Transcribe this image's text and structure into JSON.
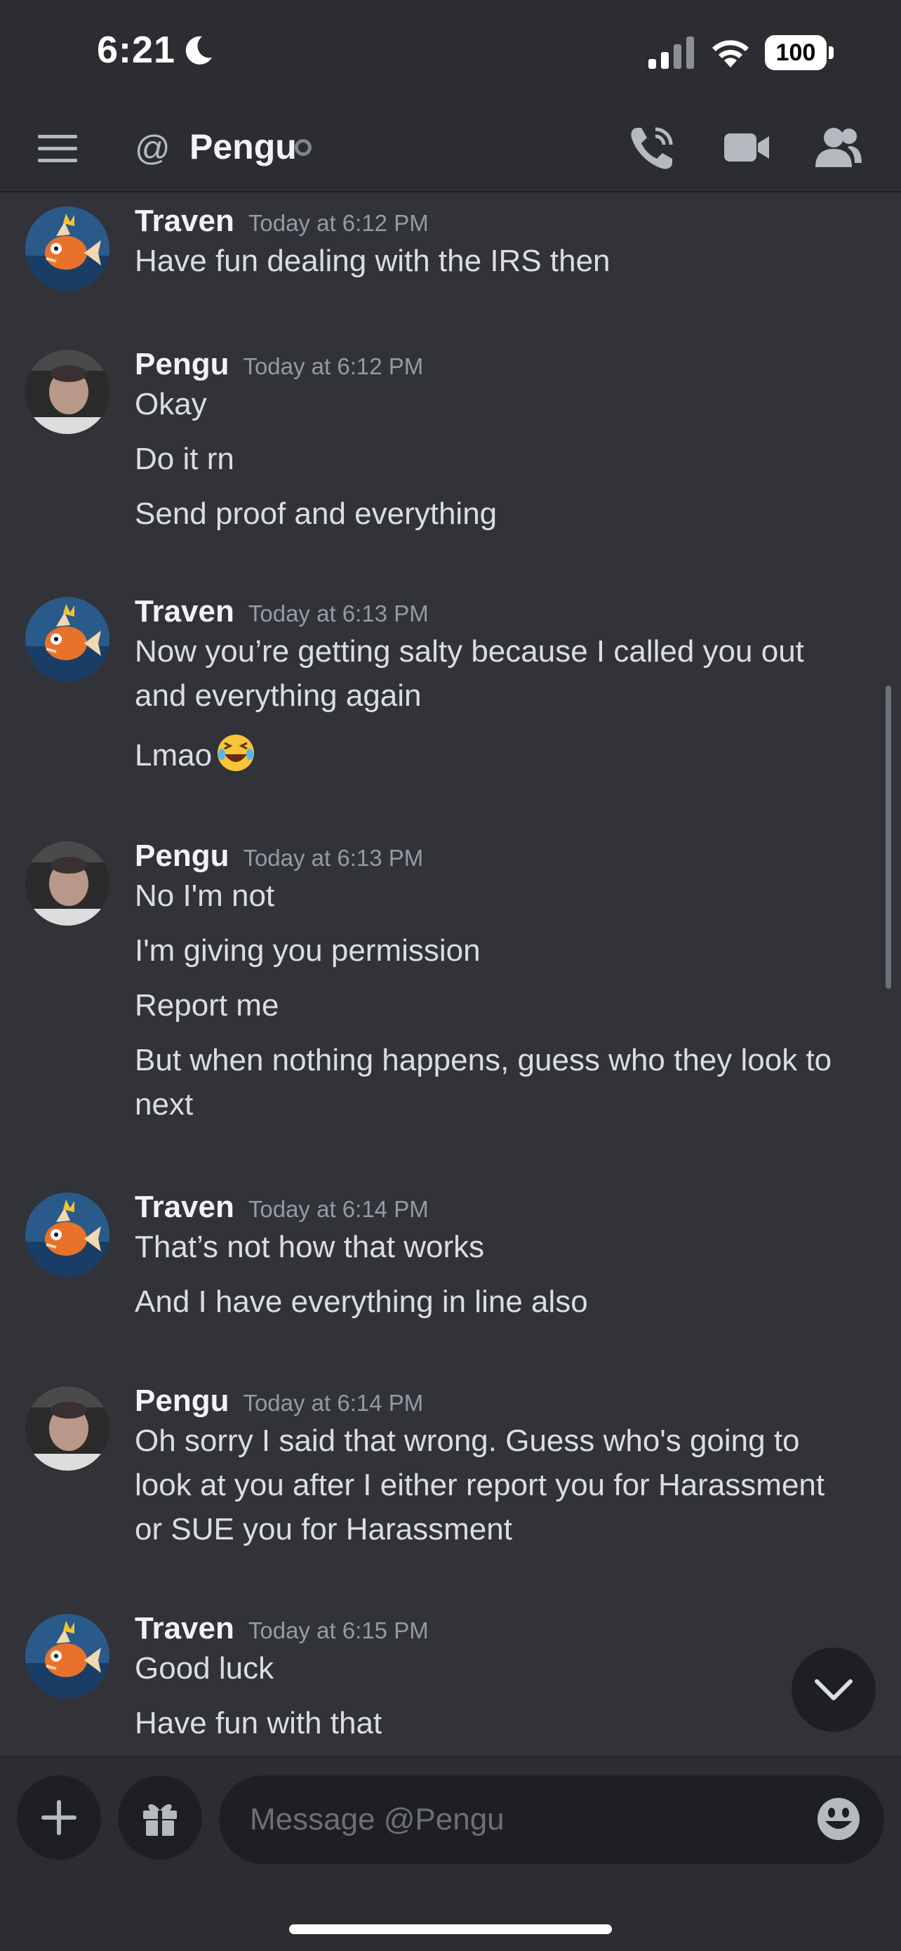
{
  "status_bar": {
    "time": "6:21",
    "battery": "100"
  },
  "header": {
    "at_symbol": "@",
    "dm_name": "Pengu"
  },
  "messages": [
    {
      "author": "Traven",
      "timestamp": "Today at 6:12 PM",
      "lines": [
        "Have fun dealing with the IRS then"
      ]
    },
    {
      "author": "Pengu",
      "timestamp": "Today at 6:12 PM",
      "lines": [
        "Okay",
        "Do it rn",
        "Send proof and everything"
      ]
    },
    {
      "author": "Traven",
      "timestamp": "Today at 6:13 PM",
      "lines": [
        "Now you’re getting salty because I called you out",
        "and everything again",
        "Lmao"
      ]
    },
    {
      "author": "Pengu",
      "timestamp": "Today at 6:13 PM",
      "lines": [
        "No I'm not",
        "I'm giving you permission",
        "Report me",
        "But when nothing happens, guess who they look to",
        "next"
      ]
    },
    {
      "author": "Traven",
      "timestamp": "Today at 6:14 PM",
      "lines": [
        "That’s not how that works",
        "And I have everything in line also"
      ]
    },
    {
      "author": "Pengu",
      "timestamp": "Today at 6:14 PM",
      "lines": [
        "Oh sorry I said that wrong. Guess who's going to",
        "look at you after I either report you for Harassment",
        "or SUE you for Harassment"
      ]
    },
    {
      "author": "Traven",
      "timestamp": "Today at 6:15 PM",
      "lines": [
        "Good luck",
        "Have fun with that"
      ]
    }
  ],
  "composer": {
    "placeholder": "Message @Pengu"
  },
  "colors": {
    "background": "#313338",
    "header": "#2b2d31",
    "input": "#1e1f22",
    "muted_text": "#949ba4"
  },
  "icons": [
    "moon-icon",
    "signal-icon",
    "wifi-icon",
    "menu-icon",
    "voice-call-icon",
    "video-call-icon",
    "members-icon",
    "chevron-down-icon",
    "plus-icon",
    "gift-icon",
    "emoji-icon",
    "laughing-emoji-icon"
  ]
}
